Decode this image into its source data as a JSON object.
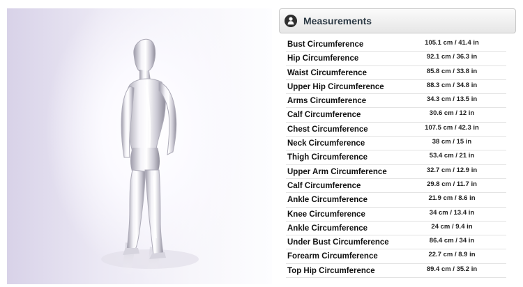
{
  "panel": {
    "title": "Measurements",
    "icon": "person-silhouette-icon"
  },
  "measurements": [
    {
      "label": "Bust Circumference",
      "value": "105.1 cm / 41.4 in"
    },
    {
      "label": "Hip Circumference",
      "value": "92.1 cm / 36.3 in"
    },
    {
      "label": "Waist Circumference",
      "value": "85.8 cm / 33.8 in"
    },
    {
      "label": "Upper Hip Circumference",
      "value": "88.3 cm / 34.8 in"
    },
    {
      "label": "Arms Circumference",
      "value": "34.3 cm / 13.5 in"
    },
    {
      "label": "Calf Circumference",
      "value": "30.6 cm / 12 in"
    },
    {
      "label": "Chest Circumference",
      "value": "107.5 cm / 42.3 in"
    },
    {
      "label": "Neck Circumference",
      "value": "38 cm / 15 in"
    },
    {
      "label": "Thigh Circumference",
      "value": "53.4 cm / 21 in"
    },
    {
      "label": "Upper Arm Circumference",
      "value": "32.7 cm / 12.9 in"
    },
    {
      "label": "Calf Circumference",
      "value": "29.8 cm / 11.7 in"
    },
    {
      "label": "Ankle Circumference",
      "value": "21.9 cm / 8.6 in"
    },
    {
      "label": "Knee Circumference",
      "value": "34 cm / 13.4 in"
    },
    {
      "label": "Ankle Circumference",
      "value": "24 cm / 9.4 in"
    },
    {
      "label": "Under Bust Circumference",
      "value": "86.4 cm / 34 in"
    },
    {
      "label": "Forearm Circumference",
      "value": "22.7 cm / 8.9 in"
    },
    {
      "label": "Top Hip Circumference",
      "value": "89.4 cm / 35.2 in"
    }
  ]
}
